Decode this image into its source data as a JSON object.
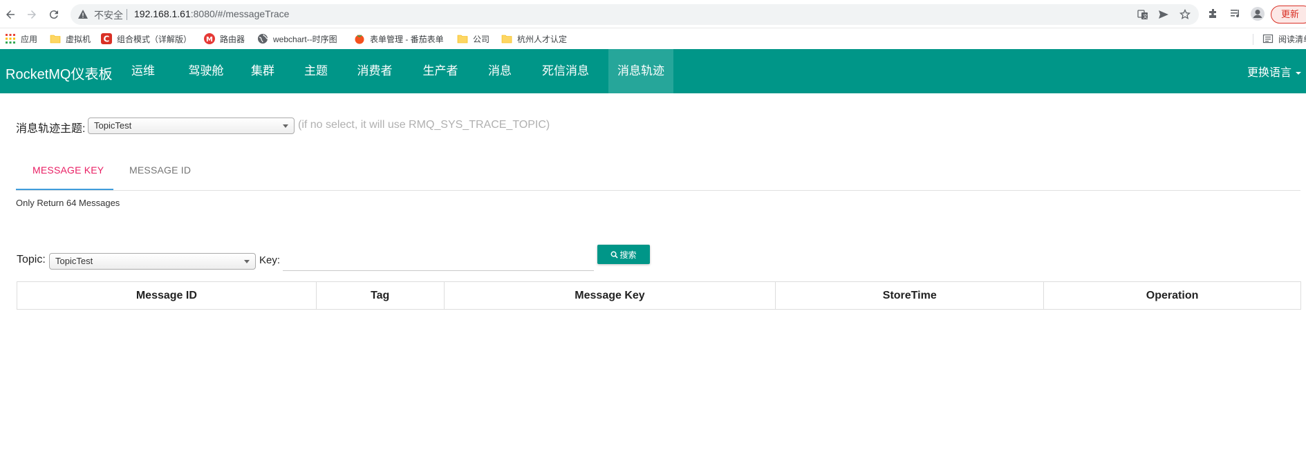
{
  "browser": {
    "insecure_label": "不安全",
    "url_host": "192.168.1.61",
    "url_rest": ":8080/#/messageTrace",
    "update_label": "更新"
  },
  "bookmarks": {
    "items": [
      {
        "label": "应用",
        "icon": "apps-grid-icon"
      },
      {
        "label": "虚拟机",
        "icon": "folder-icon"
      },
      {
        "label": "组合模式（详解版）",
        "icon": "csdn-icon"
      },
      {
        "label": "路由器",
        "icon": "router-icon"
      },
      {
        "label": "webchart--时序图",
        "icon": "globe-icon"
      },
      {
        "label": "表单管理 - 番茄表单",
        "icon": "tomato-icon"
      },
      {
        "label": "公司",
        "icon": "folder-icon"
      },
      {
        "label": "杭州人才认定",
        "icon": "folder-icon"
      }
    ],
    "reading_list": "阅读清单"
  },
  "nav": {
    "brand": "RocketMQ仪表板",
    "items": [
      "运维",
      "驾驶舱",
      "集群",
      "主题",
      "消费者",
      "生产者",
      "消息",
      "死信消息",
      "消息轨迹"
    ],
    "active": "消息轨迹",
    "language": "更换语言"
  },
  "trace": {
    "label": "消息轨迹主题:",
    "selected": "TopicTest",
    "hint": "(if no select, it will use RMQ_SYS_TRACE_TOPIC)"
  },
  "tabs": {
    "key": "MESSAGE KEY",
    "id": "MESSAGE ID"
  },
  "notice": "Only Return 64 Messages",
  "search": {
    "topic_label": "Topic:",
    "topic_selected": "TopicTest",
    "key_label": "Key:",
    "key_value": "",
    "button_label": "搜索"
  },
  "table": {
    "headers": [
      "Message ID",
      "Tag",
      "Message Key",
      "StoreTime",
      "Operation"
    ]
  },
  "colors": {
    "primary": "#009688",
    "active_tab_text": "#e91e63",
    "tab_ink": "#3f9ddb"
  }
}
